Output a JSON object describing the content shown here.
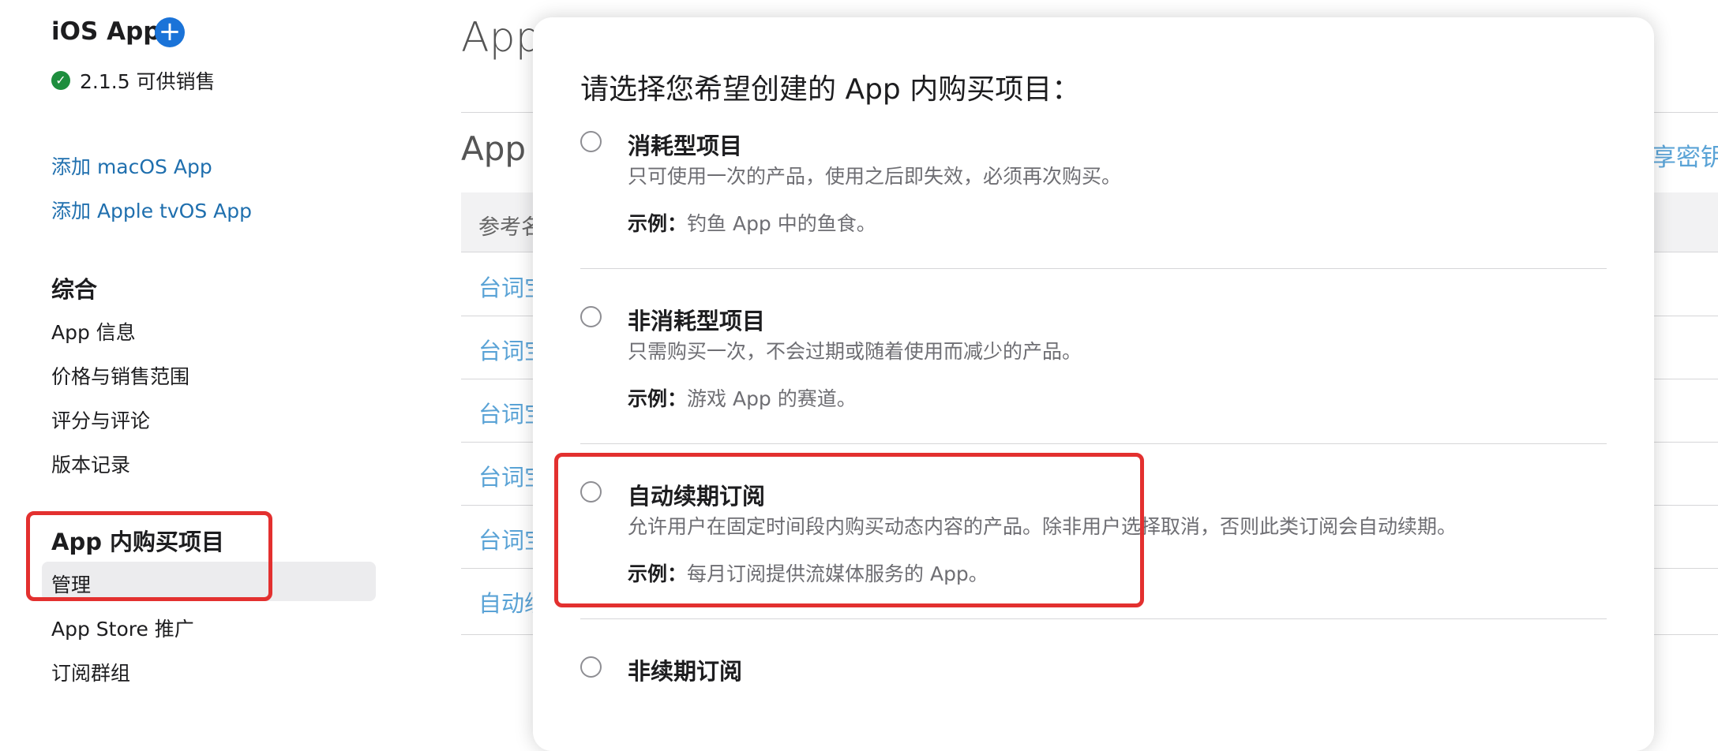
{
  "sidebar": {
    "app_title": "iOS App",
    "add_icon": "plus-circle-icon",
    "status_text": "2.1.5 可供销售",
    "links": [
      "添加 macOS App",
      "添加 Apple tvOS App"
    ],
    "general_heading": "综合",
    "general_items": [
      "App 信息",
      "价格与销售范围",
      "评分与评论",
      "版本记录"
    ],
    "iap_heading": "App 内购买项目",
    "iap_items": [
      "管理",
      "App Store 推广",
      "订阅群组"
    ]
  },
  "background": {
    "page_title": "App",
    "section_title": "App",
    "table_header": "参考名",
    "rows": [
      "台词宝",
      "台词宝",
      "台词宝",
      "台词宝",
      "台词宝",
      "自动续"
    ],
    "right_link": "享密钥"
  },
  "modal": {
    "title": "请选择您希望创建的 App 内购买项目：",
    "example_label": "示例：",
    "options": [
      {
        "title": "消耗型项目",
        "desc": "只可使用一次的产品，使用之后即失效，必须再次购买。",
        "example": "钓鱼 App 中的鱼食。"
      },
      {
        "title": "非消耗型项目",
        "desc": "只需购买一次，不会过期或随着使用而减少的产品。",
        "example": "游戏 App 的赛道。"
      },
      {
        "title": "自动续期订阅",
        "desc": "允许用户在固定时间段内购买动态内容的产品。除非用户选择取消，否则此类订阅会自动续期。",
        "example": "每月订阅提供流媒体服务的 App。"
      },
      {
        "title": "非续期订阅",
        "desc": "",
        "example": ""
      }
    ]
  },
  "colors": {
    "accent": "#1a73d8",
    "link": "#1f6fae",
    "highlight": "#e3302f",
    "success": "#1e8e3e"
  }
}
